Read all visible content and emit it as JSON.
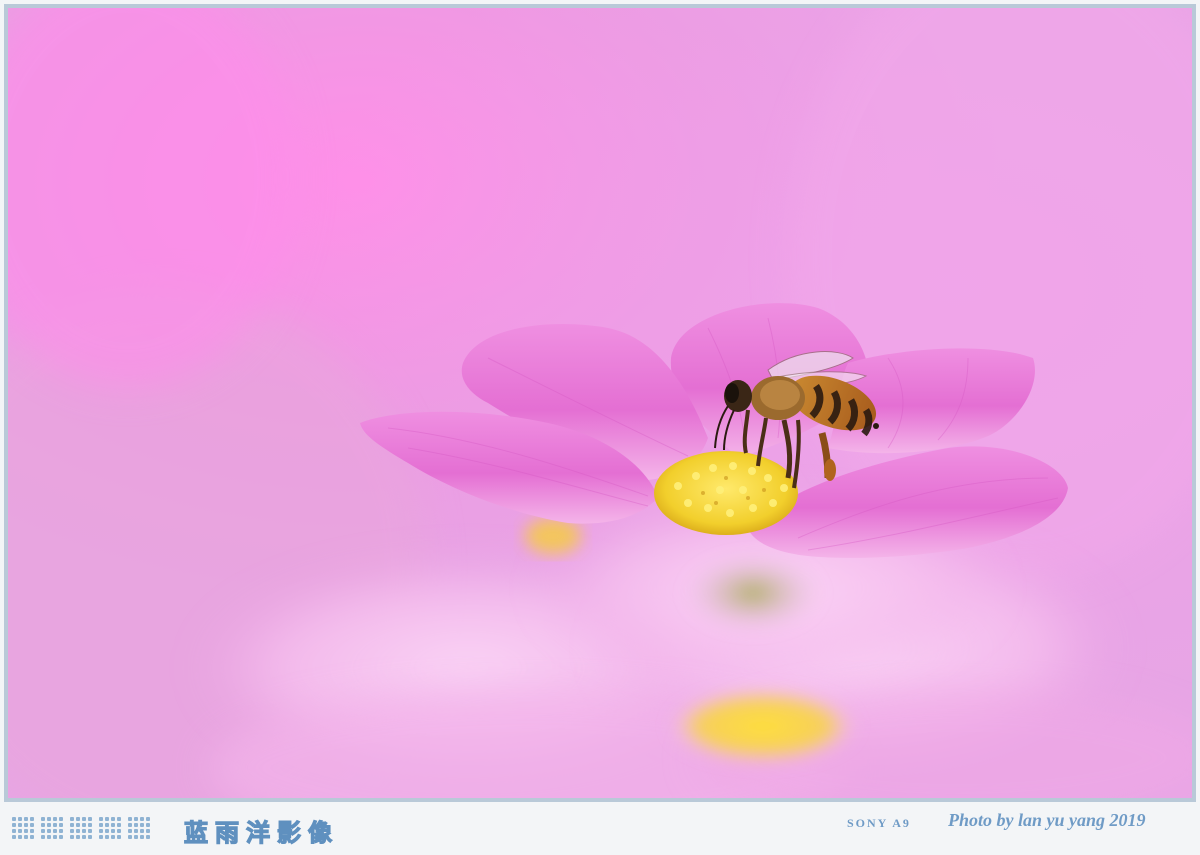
{
  "photo": {
    "subject": "bee-on-cosmos-flower",
    "colors": {
      "background": "#e89de6",
      "petal": "#e67ad8",
      "petal_light": "#f6c7ef",
      "pollen": "#f2d23a",
      "bee_body": "#c27a28",
      "bee_stripe": "#2b1a10",
      "frame": "#b9c9d8"
    }
  },
  "caption": {
    "brand_cn": "蓝雨洋影像",
    "camera": "SONY A9",
    "credit": "Photo by lan yu yang 2019",
    "accent_color": "#6f9bc6"
  },
  "icons": {
    "dot-pattern": "dot-grid-logo"
  }
}
